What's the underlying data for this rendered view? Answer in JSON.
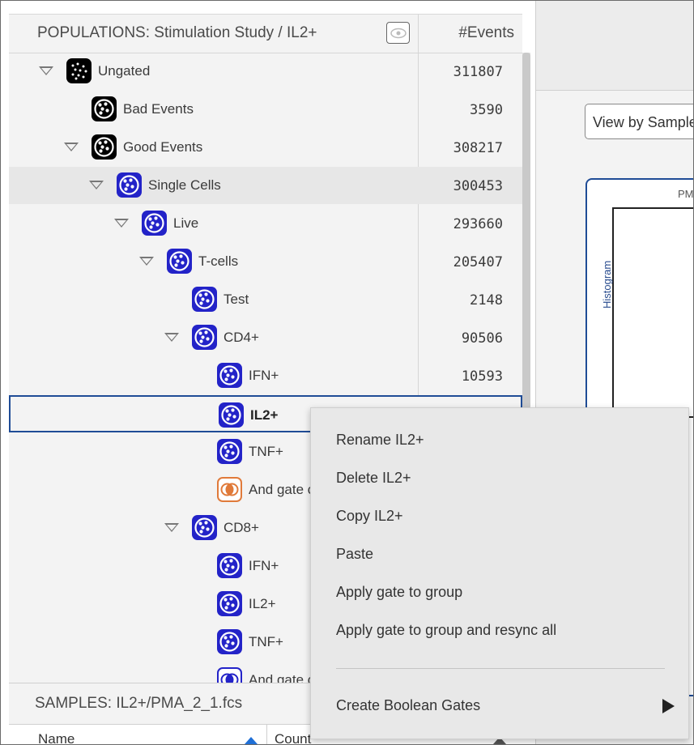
{
  "populations": {
    "title": "POPULATIONS: Stimulation Study / IL2+",
    "events_header": "#Events",
    "rows": [
      {
        "name": "Ungated",
        "count": "311807",
        "icon": "ungated-icon",
        "expanded": true
      },
      {
        "name": "Bad Events",
        "count": "3590",
        "icon": "gate-icon"
      },
      {
        "name": "Good Events",
        "count": "308217",
        "icon": "gate-icon",
        "expanded": true
      },
      {
        "name": "Single Cells",
        "count": "300453",
        "icon": "gate-icon",
        "expanded": true
      },
      {
        "name": "Live",
        "count": "293660",
        "icon": "gate-icon",
        "expanded": true
      },
      {
        "name": "T-cells",
        "count": "205407",
        "icon": "gate-icon",
        "expanded": true
      },
      {
        "name": "Test",
        "count": "2148",
        "icon": "gate-icon"
      },
      {
        "name": "CD4+",
        "count": "90506",
        "icon": "gate-icon",
        "expanded": true
      },
      {
        "name": "IFN+",
        "count": "10593",
        "icon": "gate-icon"
      },
      {
        "name": "IL2+",
        "count": "",
        "icon": "gate-icon",
        "selected": true
      },
      {
        "name": "TNF+",
        "count": "",
        "icon": "gate-icon"
      },
      {
        "name": "And gate c",
        "count": "",
        "icon": "and-gate-icon"
      },
      {
        "name": "CD8+",
        "count": "",
        "icon": "gate-icon",
        "expanded": true
      },
      {
        "name": "IFN+",
        "count": "",
        "icon": "gate-icon"
      },
      {
        "name": "IL2+",
        "count": "",
        "icon": "gate-icon"
      },
      {
        "name": "TNF+",
        "count": "",
        "icon": "gate-icon"
      },
      {
        "name": "And gate c",
        "count": "",
        "icon": "and-gate-icon"
      }
    ]
  },
  "samples": {
    "title": "SAMPLES: IL2+/PMA_2_1.fcs",
    "col_name": "Name",
    "col_count": "Count"
  },
  "right": {
    "view_button": "View by Sample",
    "plot_top_label": "PM",
    "plot_y_label": "Histogram"
  },
  "context_menu": {
    "items": [
      "Rename IL2+",
      "Delete IL2+",
      "Copy IL2+",
      "Paste",
      "Apply gate to group",
      "Apply gate to group and resync all"
    ],
    "boolean": "Create Boolean Gates"
  },
  "colors": {
    "gate_blue": "#2323c8",
    "selection_border": "#1f4c96",
    "and_gate_orange": "#e07a3a"
  }
}
